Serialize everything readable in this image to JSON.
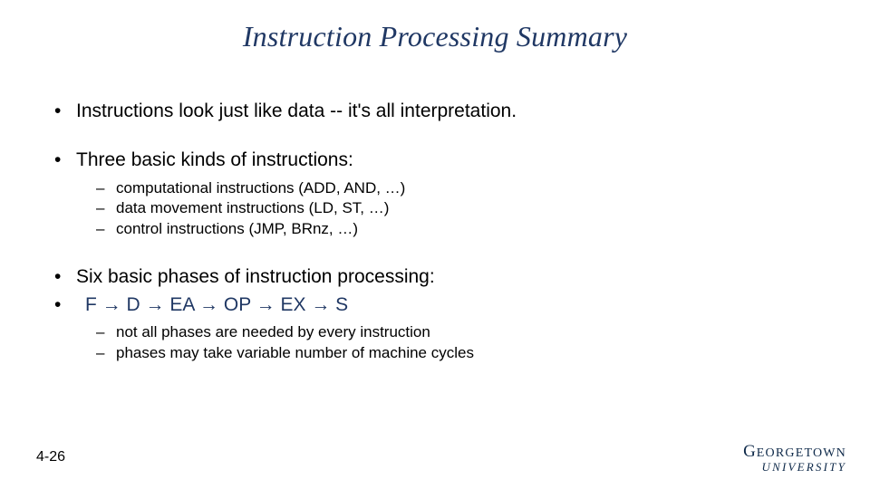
{
  "title": "Instruction Processing Summary",
  "bullets": {
    "b1": "Instructions look just like data -- it's all interpretation.",
    "b2": "Three basic kinds of instructions:",
    "b2_sub": [
      "computational instructions (ADD, AND, …)",
      "data movement instructions (LD, ST, …)",
      "control instructions (JMP, BRnz, …)"
    ],
    "b3": "Six basic phases of instruction processing:",
    "b4_phases": "F → D → EA → OP → EX → S",
    "b4_sub": [
      "not all phases are needed by every instruction",
      "phases may take variable number of machine cycles"
    ]
  },
  "page_number": "4-26",
  "logo": {
    "line1_big": "G",
    "line1_sc": "EORGETOWN",
    "line2": "UNIVERSITY"
  }
}
